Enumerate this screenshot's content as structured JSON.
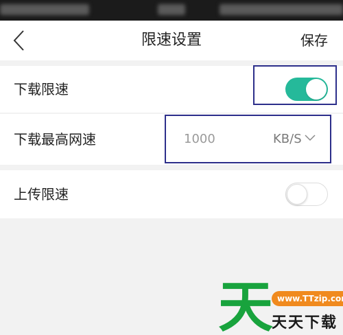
{
  "nav": {
    "title": "限速设置",
    "save_label": "保存",
    "back_icon": "chevron-left-icon"
  },
  "settings": {
    "download_limit": {
      "label": "下载限速",
      "enabled": true
    },
    "max_download_speed": {
      "label": "下载最高网速",
      "value": "1000",
      "unit": "KB/S",
      "unit_icon": "chevron-down-icon"
    },
    "upload_limit": {
      "label": "上传限速",
      "enabled": false
    }
  },
  "watermark": {
    "big_char": "天",
    "url": "www.TTzip.com",
    "text": "天天下载"
  },
  "colors": {
    "accent": "#25b99a",
    "highlight_box": "#2c2e8a",
    "watermark_green": "#18a33d",
    "watermark_orange": "#f08a1e"
  }
}
